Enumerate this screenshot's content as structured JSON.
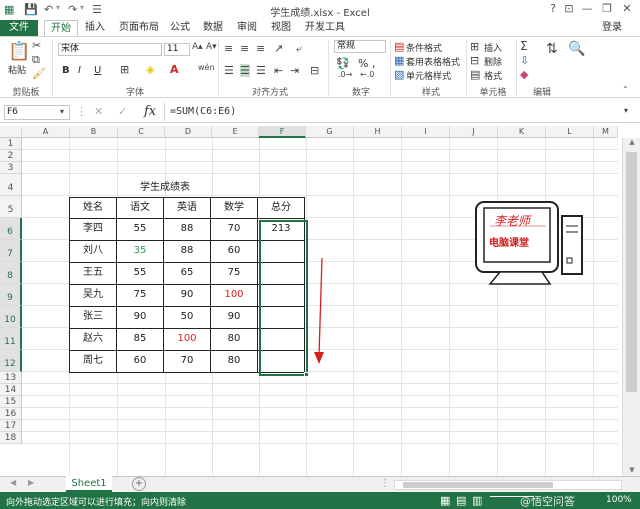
{
  "window": {
    "title": "学生成绩.xlsx - Excel",
    "help": "?",
    "minimize": "—",
    "restore": "❐",
    "close": "✕",
    "ribbon_display": "⊡",
    "login": "登录"
  },
  "tabs": [
    "文件",
    "开始",
    "插入",
    "页面布局",
    "公式",
    "数据",
    "审阅",
    "视图",
    "开发工具"
  ],
  "ribbon": {
    "paste": "粘贴",
    "clipboard": "剪贴板",
    "font_name": "宋体",
    "font_size": "11",
    "font_group": "字体",
    "bold": "B",
    "italic": "I",
    "underline": "U",
    "align_group": "对齐方式",
    "number_format": "常规",
    "number_group": "数字",
    "cond_format": "条件格式",
    "table_format": "套用表格格式",
    "cell_style": "单元格样式",
    "style_group": "样式",
    "insert": "插入",
    "delete": "删除",
    "format": "格式",
    "cells_group": "单元格",
    "edit_group": "编辑",
    "percent": "%",
    "comma": ","
  },
  "formula_bar": {
    "name_box": "F6",
    "fx": "fx",
    "formula": "=SUM(C6:E6)"
  },
  "columns": [
    "A",
    "B",
    "C",
    "D",
    "E",
    "F",
    "G",
    "H",
    "I",
    "J",
    "K",
    "L",
    "M"
  ],
  "rows": [
    "1",
    "2",
    "3",
    "4",
    "5",
    "6",
    "7",
    "8",
    "9",
    "10",
    "11",
    "12",
    "13",
    "14",
    "15",
    "16",
    "17",
    "18"
  ],
  "table": {
    "title": "学生成绩表",
    "headers": [
      "姓名",
      "语文",
      "英语",
      "数学",
      "总分"
    ],
    "rows": [
      [
        "李四",
        "55",
        "88",
        "70",
        "213"
      ],
      [
        "刘八",
        "35",
        "88",
        "60",
        ""
      ],
      [
        "王五",
        "55",
        "65",
        "75",
        ""
      ],
      [
        "吴九",
        "75",
        "90",
        "100",
        ""
      ],
      [
        "张三",
        "90",
        "50",
        "90",
        ""
      ],
      [
        "赵六",
        "85",
        "100",
        "80",
        ""
      ],
      [
        "周七",
        "60",
        "70",
        "80",
        ""
      ]
    ],
    "highlight_green": "#2e9b4f",
    "highlight_red": "#d42020"
  },
  "logo": {
    "line1": "李老师",
    "line2": "电脑课堂"
  },
  "sheet_tabs": [
    "Sheet1"
  ],
  "add_sheet": "+",
  "status": {
    "message": "向外拖动选定区域可以进行填充；向内则清除",
    "zoom": "100%",
    "watermark": "@悟空问答"
  },
  "colors": {
    "excel_green": "#217346",
    "arrow_red": "#d42020"
  }
}
